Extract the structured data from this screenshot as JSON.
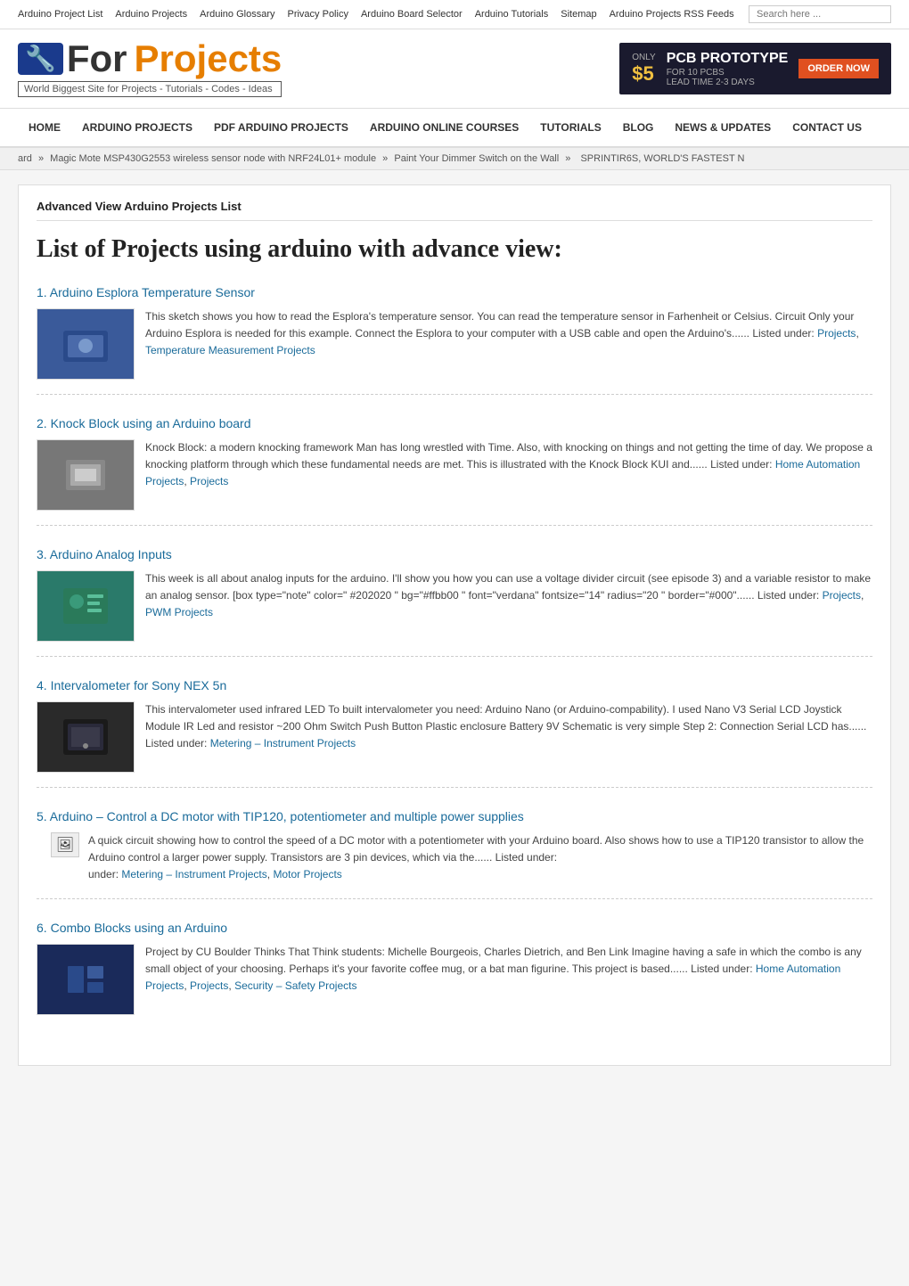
{
  "topnav": {
    "links": [
      "Arduino Project List",
      "Arduino Projects",
      "Arduino Glossary",
      "Privacy Policy",
      "Arduino Board Selector",
      "Arduino Tutorials",
      "Sitemap",
      "Arduino Projects RSS Feeds"
    ],
    "search_placeholder": "Search here ..."
  },
  "header": {
    "logo_icon": "🔧",
    "logo_for": "For",
    "logo_projects": "Projects",
    "logo_subtitle": "World Biggest Site for Projects - Tutorials - Codes - Ideas",
    "banner": {
      "price": "ONLY $5",
      "for_text": "FOR 10 PCBS",
      "pcb_text": "PCB PROTOTYPE",
      "lead_time": "LEAD TIME 2-3 DAYS",
      "order_btn": "ORDER NOW"
    }
  },
  "mainnav": {
    "items": [
      "HOME",
      "ARDUINO PROJECTS",
      "PDF ARDUINO PROJECTS",
      "ARDUINO ONLINE COURSES",
      "TUTORIALS",
      "BLOG",
      "NEWS & UPDATES",
      "CONTACT US"
    ]
  },
  "breadcrumb": {
    "parts": [
      "ard",
      "Magic Mote MSP430G2553 wireless sensor node with NRF24L01+ module",
      "Paint Your Dimmer Switch on the Wall",
      "SPRINTIR6S, WORLD'S FASTEST N"
    ]
  },
  "content": {
    "section_title": "Advanced View Arduino Projects List",
    "main_title": "List of Projects using arduino with advance view:",
    "projects": [
      {
        "number": "1",
        "title": "Arduino Esplora Temperature Sensor",
        "description": "This sketch shows you how to read the Esplora's temperature sensor. You can read the temperature sensor in Farhenheit or Celsius. Circuit Only your Arduino Esplora is needed for this example. Connect the Esplora to your computer with a USB cable and open the Arduino's...... Listed under:",
        "links": [
          "Projects",
          "Temperature Measurement Projects"
        ],
        "has_thumb": true,
        "thumb_color": "thumb-blue"
      },
      {
        "number": "2",
        "title": "Knock Block using an Arduino board",
        "description": "Knock Block: a modern knocking framework Man has long wrestled with Time. Also, with knocking on things and not getting the time of day. We propose a knocking platform through which these fundamental needs are met. This is illustrated with the Knock Block KUI and...... Listed under:",
        "links": [
          "Home Automation Projects",
          "Projects"
        ],
        "has_thumb": true,
        "thumb_color": "thumb-gray"
      },
      {
        "number": "3",
        "title": "Arduino Analog Inputs",
        "description": "This week is all about analog inputs for the arduino. I'll show you how you can use a voltage divider circuit (see episode 3) and a variable resistor to make an analog sensor. [box type=\"note\" color=\" #202020 \" bg=\"#ffbb00 \" font=\"verdana\" fontsize=\"14\" radius=\"20 \" border=\"#000\"...... Listed under:",
        "links": [
          "Projects",
          "PWM Projects"
        ],
        "has_thumb": true,
        "thumb_color": "thumb-teal"
      },
      {
        "number": "4",
        "title": "Intervalometer for Sony NEX 5n",
        "description": "This intervalometer used infrared LED To built intervalometer you need: Arduino Nano (or Arduino-compability). I used Nano V3 Serial LCD Joystick Module IR Led and resistor ~200 Ohm Switch Push Button Plastic enclosure Battery 9V Schematic is very simple Step 2: Connection Serial LCD has...... Listed under:",
        "links": [
          "Metering – Instrument Projects"
        ],
        "has_thumb": true,
        "thumb_color": "thumb-dark"
      },
      {
        "number": "5",
        "title": "Arduino – Control a DC motor with TIP120, potentiometer and multiple power supplies",
        "description": "A quick circuit showing how to control the speed of a DC motor with a potentiometer with your Arduino board. Also shows how to use a TIP120 transistor to allow the Arduino control a larger power supply. Transistors are 3 pin devices, which via the...... Listed under:",
        "links": [
          "Metering – Instrument Projects",
          "Motor Projects"
        ],
        "has_thumb": false,
        "broken_img": true
      },
      {
        "number": "6",
        "title": "Combo Blocks using an Arduino",
        "description": "Project by CU Boulder Thinks That Think students: Michelle Bourgeois, Charles Dietrich, and Ben Link Imagine having a safe in which the combo is any small object of your choosing.  Perhaps it's your favorite coffee mug, or a bat man figurine.  This project is based...... Listed under:",
        "links": [
          "Home Automation Projects",
          "Projects",
          "Security – Safety Projects"
        ],
        "has_thumb": true,
        "thumb_color": "thumb-navy"
      }
    ]
  }
}
